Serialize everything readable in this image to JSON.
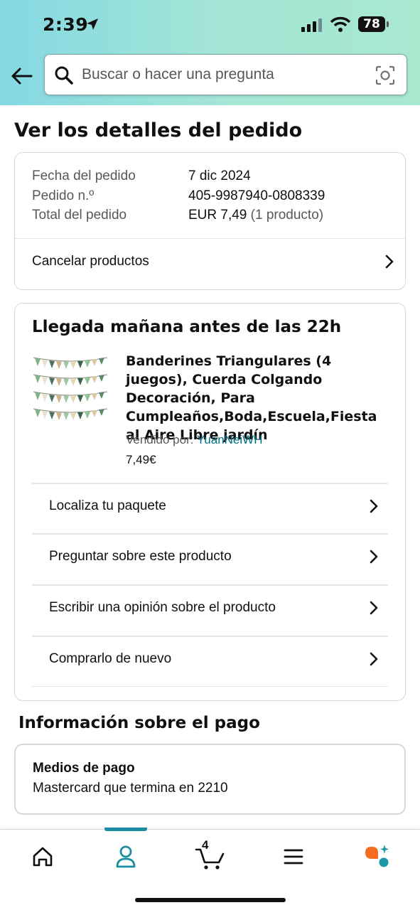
{
  "status_bar": {
    "time": "2:39",
    "battery": "78"
  },
  "search": {
    "placeholder": "Buscar o hacer una pregunta"
  },
  "page": {
    "title": "Ver los detalles del pedido"
  },
  "order_summary": {
    "date_label": "Fecha del pedido",
    "date_value": "7 dic 2024",
    "number_label": "Pedido n.º",
    "number_value": "405-9987940-0808339",
    "total_label": "Total del pedido",
    "total_value": "EUR 7,49",
    "total_count": "(1 producto)",
    "cancel_link": "Cancelar productos"
  },
  "delivery": {
    "title": "Llegada mañana antes de las 22h",
    "product_name": "Banderines Triangulares (4 juegos), Cuerda Colgando Decoración, Para Cumpleaños,Boda,Escuela,Fiesta al Aire Libre jardín",
    "seller_label": "Vendido por:",
    "seller_name": "YuanNeiWH",
    "price": "7,49€",
    "actions": [
      "Localiza tu paquete",
      "Preguntar sobre este producto",
      "Escribir una opinión sobre el producto",
      "Comprarlo de nuevo"
    ]
  },
  "payment": {
    "section_title": "Información sobre el pago",
    "methods_label": "Medios de pago",
    "methods_value": "Mastercard que termina en 2210"
  },
  "tabbar": {
    "cart_count": "4",
    "active_tab": "account",
    "accent_color": "#1a8da3",
    "icons": [
      "home-icon",
      "account-icon",
      "cart-icon",
      "menu-icon",
      "rufus-assistant-icon"
    ]
  }
}
